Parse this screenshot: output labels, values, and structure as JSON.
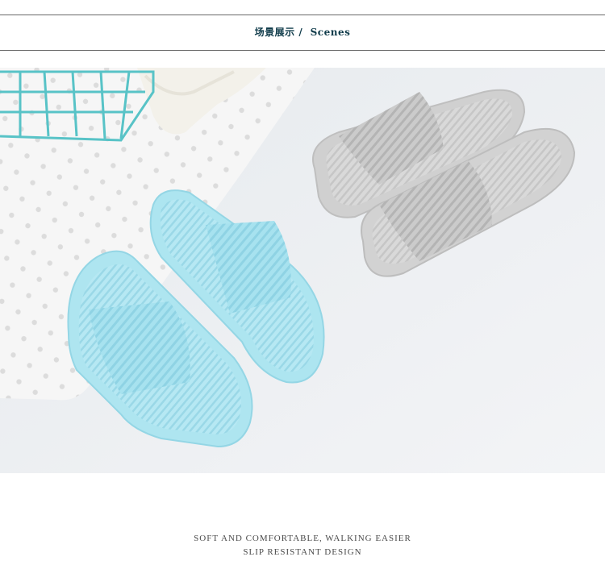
{
  "header": {
    "title_cn": "场景展示",
    "separator": "/",
    "title_en": "Scenes"
  },
  "photo": {
    "description_icon": "slippers-photo",
    "colors": {
      "blue_slipper": "#a9e4f0",
      "grey_slipper": "#c9c9c9",
      "mat": "#f4f4f4"
    }
  },
  "caption": {
    "line1": "SOFT AND COMFORTABLE, WALKING EASIER",
    "line2": "SLIP RESISTANT DESIGN"
  }
}
